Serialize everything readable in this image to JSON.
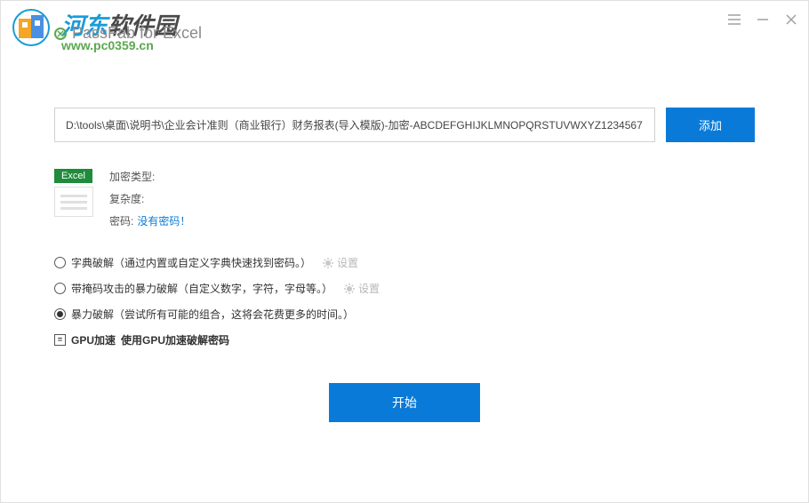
{
  "watermark": {
    "brand_colored": "河东",
    "brand_gray": "软件园",
    "url": "www.pc0359.cn"
  },
  "app": {
    "title": "PassFab for Excel"
  },
  "file": {
    "path": "D:\\tools\\桌面\\说明书\\企业会计准则（商业银行）财务报表(导入模版)-加密-ABCDEFGHIJKLMNOPQRSTUVWXYZ1234567",
    "add_button": "添加"
  },
  "info": {
    "badge": "Excel",
    "type_label": "加密类型:",
    "type_value": "",
    "complexity_label": "复杂度:",
    "complexity_value": "",
    "password_label": "密码:",
    "password_value": "没有密码！"
  },
  "options": {
    "dict": "字典破解（通过内置或自定义字典快速找到密码。）",
    "mask": "带掩码攻击的暴力破解（自定义数字，字符，字母等。）",
    "brute": "暴力破解（尝试所有可能的组合，这将会花费更多的时间。）",
    "settings": "设置",
    "gpu_label": "GPU加速",
    "gpu_desc": "使用GPU加速破解密码"
  },
  "actions": {
    "start": "开始"
  }
}
